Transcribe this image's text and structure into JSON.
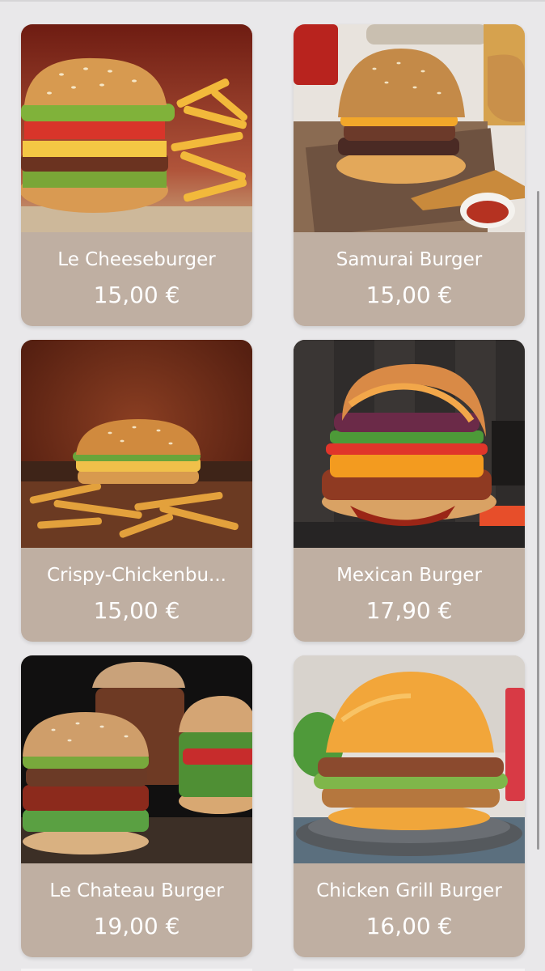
{
  "products": [
    {
      "name": "Le Cheeseburger",
      "price": "15,00 €"
    },
    {
      "name": "Samurai Burger",
      "price": "15,00 €"
    },
    {
      "name": "Crispy-Chickenbu...",
      "price": "15,00 €"
    },
    {
      "name": "Mexican Burger",
      "price": "17,90 €"
    },
    {
      "name": "Le Chateau Burger",
      "price": "19,00 €"
    },
    {
      "name": "Chicken Grill Burger",
      "price": "16,00 €"
    }
  ],
  "colors": {
    "page_background": "#e9e8ea",
    "card_background": "#bfafa2",
    "text": "#ffffff"
  }
}
